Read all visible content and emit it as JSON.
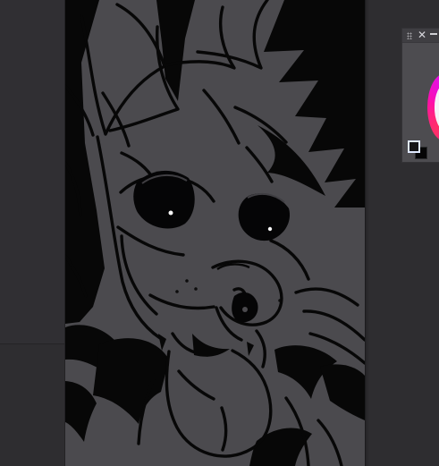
{
  "app": {
    "canvas_icon": "canvas-image",
    "color_panel_grip_icon": "drag-handle-icon",
    "color_panel_close_icon": "close-icon",
    "color_panel_minimize_icon": "minimize-icon",
    "colors": {
      "workspace": "#2e2d30",
      "canvas": "#4b4a4e",
      "line_art": "#070707",
      "panel": "#4a494d",
      "wheel_accent": "#ff1d8f",
      "foreground_swatch": "#141416",
      "background_swatch": "#050506"
    }
  }
}
